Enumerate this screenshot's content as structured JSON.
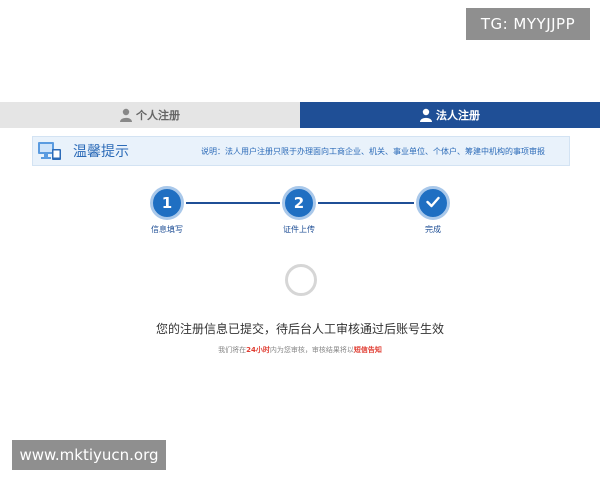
{
  "overlay": {
    "tg_badge": "TG: MYYJJPP",
    "watermark": "www.mktiyucn.org"
  },
  "tabs": [
    {
      "label": "个人注册",
      "active": false,
      "icon": "user-icon"
    },
    {
      "label": "法人注册",
      "active": true,
      "icon": "user-icon"
    }
  ],
  "notice": {
    "icon": "monitor-icon",
    "title": "温馨提示",
    "text": "说明：法人用户注册只限于办理面向工商企业、机关、事业单位、个体户、筹建中机构的事项审报"
  },
  "steps": [
    {
      "number": "1",
      "label": "信息填写",
      "status": "done"
    },
    {
      "number": "2",
      "label": "证件上传",
      "status": "done"
    },
    {
      "number": "",
      "label": "完成",
      "status": "current",
      "icon": "check-icon"
    }
  ],
  "status": {
    "message": "您的注册信息已提交，待后台人工审核通过后账号生效",
    "sub_prefix": "我们将在",
    "sub_highlight_1": "24小时",
    "sub_middle": "内为您审核，审核结果将以",
    "sub_highlight_2": "短信告知"
  },
  "colors": {
    "primary": "#1f4f96",
    "step_fill": "#1f6fc2",
    "notice_bg": "#e9f2fb",
    "highlight": "#e03c31"
  }
}
